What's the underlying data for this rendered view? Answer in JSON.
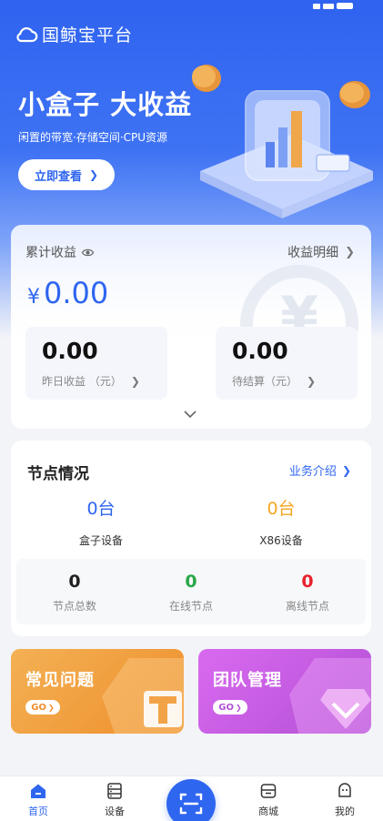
{
  "header": {
    "platform_name": "国鲸宝平台",
    "banner_title": "小盒子 大收益",
    "banner_subtitle": "闲置的带宽·存储空间·CPU资源",
    "banner_button": "立即查看"
  },
  "earnings": {
    "total_label": "累计收益",
    "detail_link": "收益明细",
    "currency": "¥",
    "total_value": "0.00",
    "yesterday_value": "0.00",
    "yesterday_label": "昨日收益 （元）",
    "pending_value": "0.00",
    "pending_label": "待结算（元）"
  },
  "nodes": {
    "title": "节点情况",
    "intro_link": "业务介绍",
    "box_count": "0台",
    "box_label": "盒子设备",
    "x86_count": "0台",
    "x86_label": "X86设备",
    "total_value": "0",
    "total_label": "节点总数",
    "online_value": "0",
    "online_label": "在线节点",
    "offline_value": "0",
    "offline_label": "离线节点"
  },
  "promos": {
    "faq_title": "常见问题",
    "faq_go": "GO",
    "team_title": "团队管理",
    "team_go": "GO"
  },
  "tabbar": {
    "home": "首页",
    "devices": "设备",
    "mall": "商城",
    "mine": "我的"
  },
  "colors": {
    "primary": "#2f66f0",
    "box_count": "#2f66f0",
    "x86_count": "#f5a623",
    "online": "#2aa84a",
    "offline": "#e8232e",
    "faq_gradient": "#f4a03a",
    "team_gradient": "#c65ae0"
  },
  "icons": {
    "platform": "cloud-icon",
    "eye": "eye-icon",
    "expand": "chevron-down-icon",
    "scan": "scan-icon"
  }
}
